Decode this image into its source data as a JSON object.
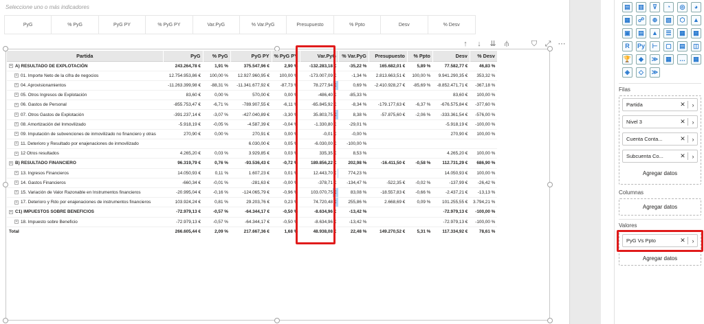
{
  "slicer": {
    "title": "Seleccione uno o más indicadores",
    "chips": [
      "PyG",
      "% PyG",
      "PyG PY",
      "% PyG PY",
      "Var.PyG",
      "% Var.PyG",
      "Presupuesto",
      "% Ppto",
      "Desv",
      "% Desv"
    ]
  },
  "toolbar": {
    "icons": [
      "arrow-up-icon",
      "arrow-down-icon",
      "double-arrow-down-icon",
      "expand-hierarchy-icon",
      "filter-icon",
      "focus-mode-icon",
      "more-options-icon"
    ]
  },
  "table": {
    "headers": [
      "Partida",
      "PyG",
      "% PyG",
      "PyG PY",
      "% PyG PY",
      "Var.PyG",
      "% Var.PyG",
      "Presupuesto",
      "% Ppto",
      "Desv",
      "% Desv"
    ],
    "rows": [
      {
        "type": "grp",
        "cells": [
          "A) RESULTADO DE EXPLOTACIÓN",
          "243.264,78 €",
          "1,91 %",
          "375.547,96 €",
          "2,90 %",
          "-132.283,18 €",
          "-35,22 %",
          "165.682,01 €",
          "5,89 %",
          "77.582,77 €",
          "46,83 %"
        ]
      },
      {
        "type": "sub",
        "cells": [
          "01. Importe Neto de la cifra de negocios",
          "12.754.953,86 €",
          "100,00 %",
          "12.927.960,95 €",
          "100,00 %",
          "-173.007,09 €",
          "-1,34 %",
          "2.813.663,51 €",
          "100,00 %",
          "9.941.290,35 €",
          "353,32 %"
        ]
      },
      {
        "type": "sub",
        "cells": [
          "04. Aprovisionamientos",
          "-11.263.399,98 €",
          "-88,31 %",
          "-11.341.677,92 €",
          "-87,73 %",
          "78.277,94 €",
          "0,69 %",
          "-2.410.928,27 €",
          "-85,69 %",
          "-8.852.471,71 €",
          "-367,18 %"
        ]
      },
      {
        "type": "sub",
        "cells": [
          "05. Otros Ingresos de Explotación",
          "83,60 €",
          "0,00 %",
          "570,00 €",
          "0,00 %",
          "-486,40 €",
          "-85,33 %",
          "",
          "",
          "83,60 €",
          "100,00 %"
        ]
      },
      {
        "type": "sub",
        "cells": [
          "06. Gastos de Personal",
          "-855.753,47 €",
          "-6,71 %",
          "-789.907,55 €",
          "-6,11 %",
          "-65.845,92 €",
          "-8,34 %",
          "-179.177,63 €",
          "-6,37 %",
          "-676.575,84 €",
          "-377,60 %"
        ]
      },
      {
        "type": "sub",
        "cells": [
          "07. Otros Gastos de Explotación",
          "-391.237,14 €",
          "-3,07 %",
          "-427.040,89 €",
          "-3,30 %",
          "35.803,75 €",
          "8,38 %",
          "-57.875,60 €",
          "-2,06 %",
          "-333.361,54 €",
          "-576,00 %"
        ]
      },
      {
        "type": "sub",
        "cells": [
          "08. Amortización del Inmovilizado",
          "-5.918,19 €",
          "-0,05 %",
          "-4.587,39 €",
          "-0,04 %",
          "-1.330,80 €",
          "-29,01 %",
          "",
          "",
          "-5.918,19 €",
          "-100,00 %"
        ]
      },
      {
        "type": "sub",
        "cells": [
          "09. Imputación de subvenciones de inmovilizado no financiero y otras",
          "270,90 €",
          "0,00 %",
          "270,91 €",
          "0,00 %",
          "-0,01 €",
          "-0,00 %",
          "",
          "",
          "270,90 €",
          "100,00 %"
        ]
      },
      {
        "type": "sub",
        "cells": [
          "11. Deterioro y Resultado por enajenaciones de inmovilizado",
          "",
          "",
          "6.030,00 €",
          "0,05 %",
          "-6.030,00 €",
          "-100,00 %",
          "",
          "",
          "",
          ""
        ]
      },
      {
        "type": "sub",
        "cells": [
          "12 Otros resultados",
          "4.265,20 €",
          "0,03 %",
          "3.929,85 €",
          "0,03 %",
          "335,35 €",
          "8,53 %",
          "",
          "",
          "4.265,20 €",
          "100,00 %"
        ]
      },
      {
        "type": "grp",
        "cells": [
          "B) RESULTADO FINANCIERO",
          "96.319,79 €",
          "0,76 %",
          "-93.536,43 €",
          "-0,72 %",
          "189.856,22 €",
          "202,98 %",
          "-16.411,50 €",
          "-0,58 %",
          "112.731,29 €",
          "686,90 %"
        ]
      },
      {
        "type": "sub",
        "cells": [
          "13. Ingresos Financieros",
          "14.050,93 €",
          "0,11 %",
          "1.607,23 €",
          "0,01 %",
          "12.443,70 €",
          "774,23 %",
          "",
          "",
          "14.050,93 €",
          "100,00 %"
        ]
      },
      {
        "type": "sub",
        "cells": [
          "14. Gastos Financieros",
          "-660,34 €",
          "-0,01 %",
          "-281,63 €",
          "-0,00 %",
          "-378,71 €",
          "-134,47 %",
          "-522,35 €",
          "-0,02 %",
          "-137,99 €",
          "-26,42 %"
        ]
      },
      {
        "type": "sub",
        "cells": [
          "15. Variación de Valor Razonable en Instrumentos financieros",
          "-20.995,04 €",
          "-0,16 %",
          "-124.065,79 €",
          "-0,96 %",
          "103.070,75 €",
          "83,08 %",
          "-18.557,83 €",
          "-0,66 %",
          "-2.437,21 €",
          "-13,13 %"
        ]
      },
      {
        "type": "sub",
        "cells": [
          "17. Deterioro y Rdo por enajenaciones de instrumentos financieros",
          "103.924,24 €",
          "0,81 %",
          "29.203,76 €",
          "0,23 %",
          "74.720,48 €",
          "255,86 %",
          "2.668,69 €",
          "0,09 %",
          "101.255,55 €",
          "3.794,21 %"
        ]
      },
      {
        "type": "grp",
        "cells": [
          "C1) IMPUESTOS SOBRE BENEFICIOS",
          "-72.979,13 €",
          "-0,57 %",
          "-64.344,17 €",
          "-0,50 %",
          "-8.634,96 €",
          "-13,42 %",
          "",
          "",
          "-72.979,13 €",
          "-100,00 %"
        ]
      },
      {
        "type": "sub",
        "cells": [
          "18. Impuesto sobre Beneficio",
          "-72.979,13 €",
          "-0,57 %",
          "-64.344,17 €",
          "-0,50 %",
          "-8.634,96 €",
          "-13,42 %",
          "",
          "",
          "-72.979,13 €",
          "-100,00 %"
        ]
      },
      {
        "type": "tot",
        "cells": [
          "Total",
          "266.605,44 €",
          "2,09 %",
          "217.667,36 €",
          "1,68 %",
          "48.938,08 €",
          "22,48 %",
          "149.270,52 €",
          "5,31 %",
          "117.334,92 €",
          "78,61 %"
        ]
      }
    ],
    "databar_fraction": [
      0,
      0,
      0.13,
      0,
      0,
      0.11,
      0,
      0,
      0,
      0,
      0,
      0.02,
      0,
      0.14,
      0.09,
      0,
      0,
      0
    ]
  },
  "pane": {
    "viz_icons": [
      "stacked-bar-icon",
      "clustered-column-icon",
      "funnel-icon",
      "gauge-icon",
      "donut-icon",
      "pie-icon",
      "table-icon",
      "key-influencers-icon",
      "map-icon",
      "filled-map-icon",
      "shape-map-icon",
      "azure-map-icon",
      "card-icon",
      "multi-row-card-icon",
      "kpi-icon",
      "slicer-icon",
      "table-visual-icon",
      "matrix-icon",
      "r-visual-icon",
      "python-visual-icon",
      "decomposition-tree-icon",
      "qa-icon",
      "smart-narrative-icon",
      "paginated-icon",
      "trophy-icon",
      "power-apps-icon",
      "power-automate-icon",
      "more-visuals-icon",
      "ellipsis-icon",
      "custom-visual-icon",
      "arcgis-icon",
      "diamond-icon",
      "chevrons-icon"
    ],
    "viz_glyphs": [
      "▤",
      "▥",
      "⊽",
      "◔",
      "◎",
      "◕",
      "▦",
      "☍",
      "⊕",
      "▧",
      "⬡",
      "▲",
      "▣",
      "▤",
      "▲",
      "☰",
      "▦",
      "▦",
      "R",
      "Py",
      "⊢",
      "▢",
      "▤",
      "◫",
      "🏆",
      "◆",
      "≫",
      "▦",
      "…",
      "▦",
      "◈",
      "◇",
      "≫"
    ],
    "filas_title": "Filas",
    "filas": [
      "Partida",
      "Nivel 3",
      "Cuenta Conta...",
      "Subcuenta Co..."
    ],
    "add_data": "Agregar datos",
    "columnas_title": "Columnas",
    "valores_title": "Valores",
    "valores": [
      "PyG Vs Ppto"
    ],
    "highlight_color": "#e01b1b"
  }
}
